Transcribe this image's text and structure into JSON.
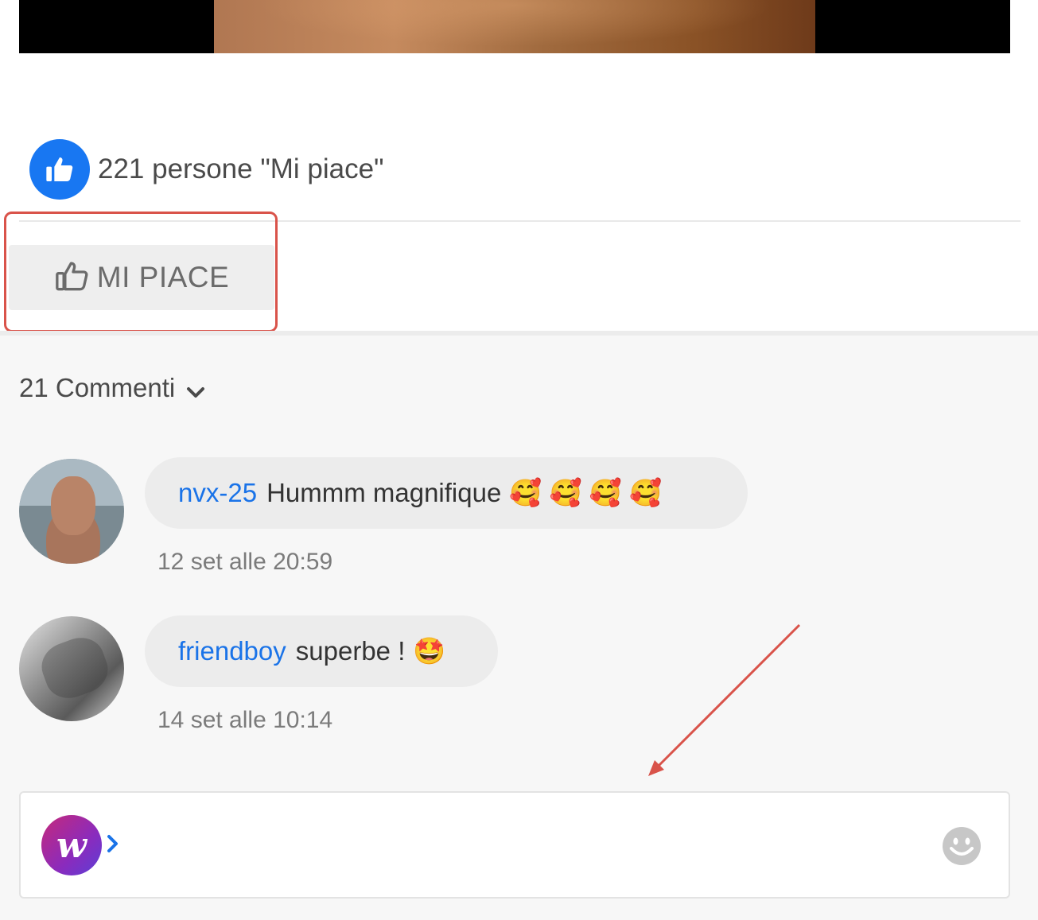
{
  "likes": {
    "summary": "221 persone \"Mi piace\""
  },
  "actions": {
    "like_label": "MI PIACE"
  },
  "comments": {
    "count_label": "21 Commenti",
    "items": [
      {
        "author": "nvx-25",
        "text": "Hummm magnifique",
        "emoji": "🥰 🥰 🥰 🥰",
        "time": "12 set alle 20:59"
      },
      {
        "author": "friendboy",
        "text": "superbe !",
        "emoji": "🤩",
        "time": "14 set alle 10:14"
      }
    ]
  },
  "composer": {
    "placeholder": ""
  },
  "colors": {
    "accent": "#1877f2",
    "link": "#1a73e8",
    "annotation": "#d9534a"
  },
  "icons": [
    "thumbs-up-icon",
    "thumbs-up-outline-icon",
    "chevron-down-icon",
    "brand-w-icon",
    "chevron-right-icon",
    "smiley-icon"
  ]
}
